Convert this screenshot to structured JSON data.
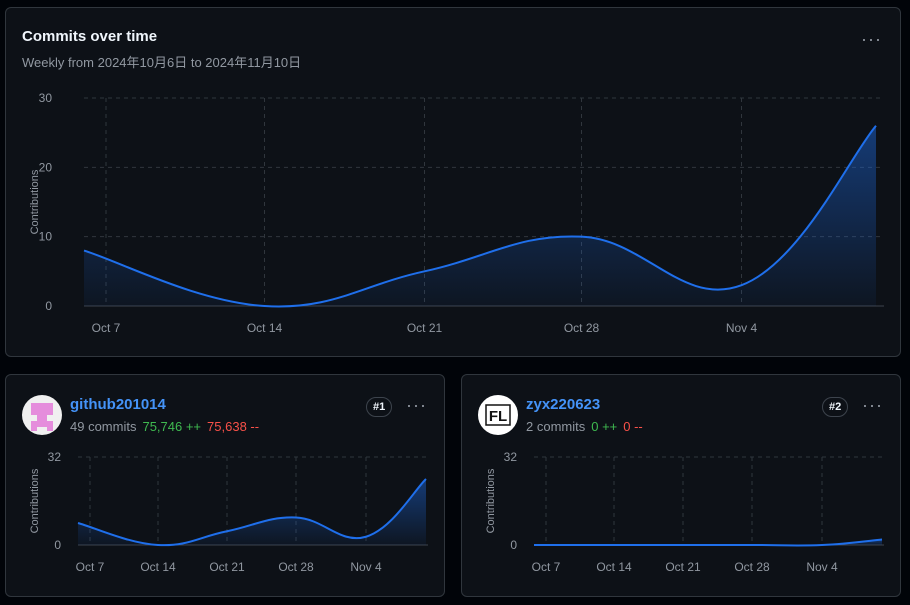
{
  "header": {
    "title": "Commits over time",
    "subtitle": "Weekly from 2024年10月6日 to 2024年11月10日"
  },
  "menu_glyph": "···",
  "colors": {
    "line": "#1f6feb",
    "grid": "#30363d",
    "text": "#9198a1",
    "link": "#4493f8",
    "add": "#3fb950",
    "del": "#f85149"
  },
  "chart_data": [
    {
      "type": "area",
      "ylabel": "Contributions",
      "ylim": [
        0,
        30
      ],
      "yticks": [
        "0",
        "10",
        "20",
        "30"
      ],
      "xticks": [
        "Oct 7",
        "Oct 14",
        "Oct 21",
        "Oct 28",
        "Nov 4"
      ],
      "series": [
        {
          "values": [
            8,
            0,
            5,
            10,
            3,
            26
          ]
        }
      ]
    },
    {
      "type": "area",
      "ylabel": "Contributions",
      "ylim": [
        0,
        32
      ],
      "yticks": [
        "0",
        "32"
      ],
      "xticks": [
        "Oct 7",
        "Oct 14",
        "Oct 21",
        "Oct 28",
        "Nov 4"
      ],
      "series": [
        {
          "values": [
            8,
            0,
            5,
            10,
            3,
            24
          ]
        }
      ]
    },
    {
      "type": "area",
      "ylabel": "Contributions",
      "ylim": [
        0,
        32
      ],
      "yticks": [
        "0",
        "32"
      ],
      "xticks": [
        "Oct 7",
        "Oct 14",
        "Oct 21",
        "Oct 28",
        "Nov 4"
      ],
      "series": [
        {
          "values": [
            0,
            0,
            0,
            0,
            0,
            2
          ]
        }
      ]
    }
  ],
  "contributors": [
    {
      "username": "github201014",
      "commits": "49 commits",
      "additions": "75,746 ++",
      "deletions": "75,638 --",
      "rank": "#1",
      "avatar_icon": "pink-identicon"
    },
    {
      "username": "zyx220623",
      "commits": "2 commits",
      "additions": "0 ++",
      "deletions": "0 --",
      "rank": "#2",
      "avatar_icon": "fl-logo",
      "avatar_text": "FL"
    }
  ]
}
